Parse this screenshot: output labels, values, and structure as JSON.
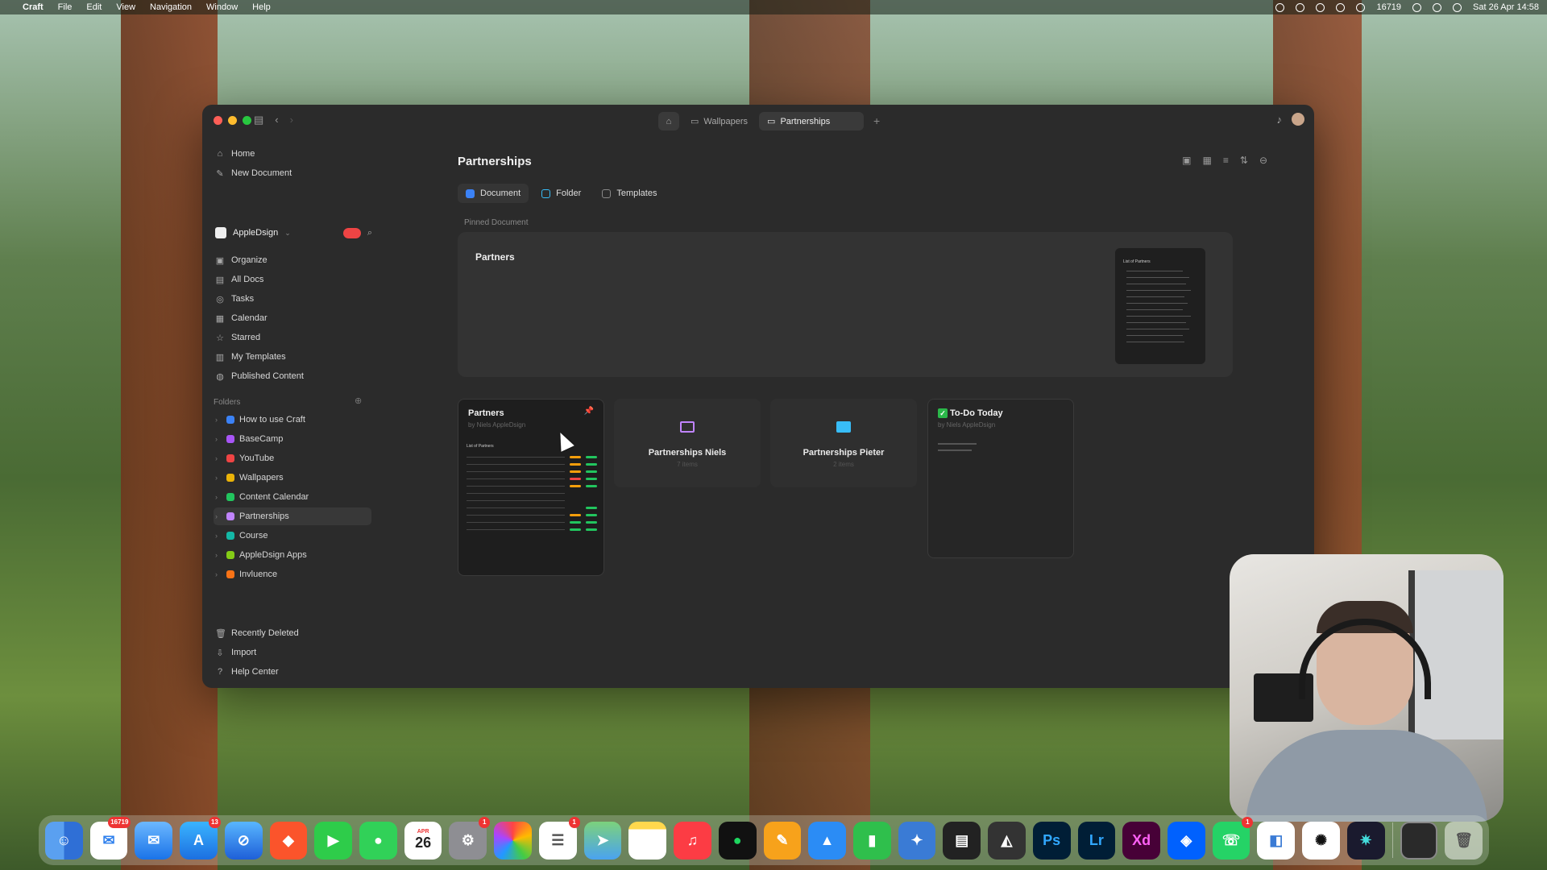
{
  "menubar": {
    "app_name": "Craft",
    "menus": [
      "File",
      "Edit",
      "View",
      "Navigation",
      "Window",
      "Help"
    ],
    "counter": "16719",
    "datetime": "Sat 26 Apr 14:58"
  },
  "window": {
    "tabs": [
      {
        "label": "Wallpapers"
      },
      {
        "label": "Partnerships"
      }
    ]
  },
  "sidebar": {
    "home": "Home",
    "new_document": "New Document",
    "workspace": "AppleDsign",
    "nav": [
      "Organize",
      "All Docs",
      "Tasks",
      "Calendar",
      "Starred",
      "My Templates",
      "Published Content"
    ],
    "folders_label": "Folders",
    "folders": [
      {
        "name": "How to use Craft",
        "color": "#3b82f6"
      },
      {
        "name": "BaseCamp",
        "color": "#a855f7"
      },
      {
        "name": "YouTube",
        "color": "#ef4444"
      },
      {
        "name": "Wallpapers",
        "color": "#eab308"
      },
      {
        "name": "Content Calendar",
        "color": "#22c55e"
      },
      {
        "name": "Partnerships",
        "color": "#c084fc"
      },
      {
        "name": "Course",
        "color": "#14b8a6"
      },
      {
        "name": "AppleDsign Apps",
        "color": "#84cc16"
      },
      {
        "name": "Invluence",
        "color": "#f97316"
      }
    ],
    "bottom": [
      "Recently Deleted",
      "Import",
      "Help Center"
    ]
  },
  "main": {
    "title": "Partnerships",
    "new_buttons": [
      "Document",
      "Folder",
      "Templates"
    ],
    "pinned_label": "Pinned Document",
    "pinned": {
      "title": "Partners",
      "thumb_title": "List of Partners"
    },
    "cards": [
      {
        "type": "doc",
        "title": "Partners",
        "subtitle": "by Niels AppleDsign",
        "mini_title": "List of Partners"
      },
      {
        "type": "folder",
        "title": "Partnerships Niels",
        "count": "7 items",
        "color": "#c084fc"
      },
      {
        "type": "folder",
        "title": "Partnerships Pieter",
        "count": "2 items",
        "color": "#38bdf8"
      },
      {
        "type": "todo",
        "title": "To-Do Today",
        "subtitle": "by Niels AppleDsign"
      }
    ]
  },
  "dock": {
    "badges": {
      "mail": "16719",
      "appstore": "13",
      "settings": "1",
      "reminders": "1",
      "whatsapp": "1"
    },
    "calendar_day": "26",
    "calendar_month": "APR",
    "apps": [
      "Finder",
      "Mail",
      "Mail2",
      "App Store",
      "Safari",
      "Brave",
      "FaceTime",
      "Messages",
      "Calendar",
      "System Settings",
      "Photos",
      "Reminders",
      "Maps",
      "Notes",
      "Music",
      "Spotify",
      "Pages",
      "Keynote",
      "Numbers",
      "Craft",
      "Final Cut",
      "Logic",
      "Ps",
      "Lr",
      "Xd",
      "Dropbox",
      "WhatsApp",
      "Craft Docs",
      "ChatGPT",
      "Figma",
      "Screen",
      "Trash"
    ]
  }
}
